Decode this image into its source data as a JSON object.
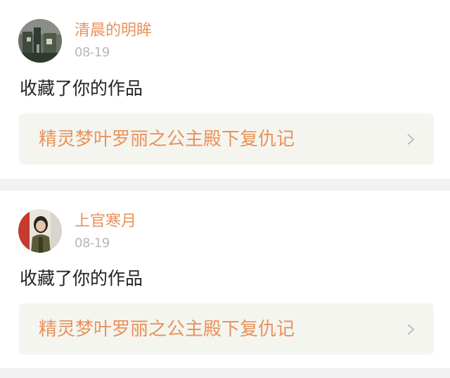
{
  "colors": {
    "accent": "#e8925a",
    "date": "#b8b8b8",
    "text": "#222222",
    "link_bg": "#f5f5f0",
    "page_bg": "#f2f2f2"
  },
  "feed": [
    {
      "user": "清晨的明眸",
      "date": "08-19",
      "action": "收藏了你的作品",
      "work_title": "精灵梦叶罗丽之公主殿下复仇记",
      "chevron": "chevron-right-icon"
    },
    {
      "user": "上官寒月",
      "date": "08-19",
      "action": "收藏了你的作品",
      "work_title": "精灵梦叶罗丽之公主殿下复仇记",
      "chevron": "chevron-right-icon"
    }
  ]
}
